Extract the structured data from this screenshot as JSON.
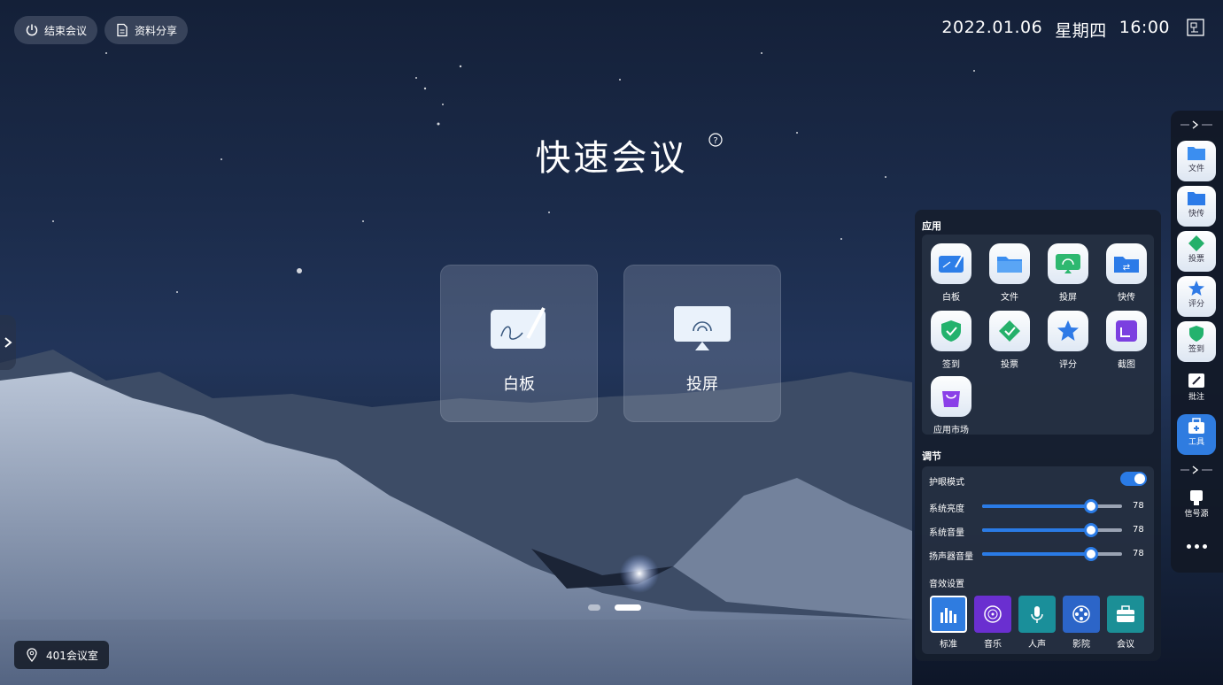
{
  "top": {
    "end_meeting": "结束会议",
    "share_material": "资料分享",
    "date": "2022.01.06",
    "weekday": "星期四",
    "time": "16:00"
  },
  "main": {
    "title": "快速会议",
    "cards": [
      {
        "label": "白板",
        "icon": "whiteboard-icon"
      },
      {
        "label": "投屏",
        "icon": "screencast-icon"
      }
    ]
  },
  "room": {
    "name": "401会议室"
  },
  "pager": {
    "pages": 2,
    "active": 2
  },
  "panel": {
    "apps_title": "应用",
    "apps": [
      {
        "label": "白板",
        "icon": "whiteboard-icon"
      },
      {
        "label": "文件",
        "icon": "folder-icon"
      },
      {
        "label": "投屏",
        "icon": "screencast-icon"
      },
      {
        "label": "快传",
        "icon": "transfer-folder-icon"
      },
      {
        "label": "签到",
        "icon": "checkin-shield-icon"
      },
      {
        "label": "投票",
        "icon": "vote-icon"
      },
      {
        "label": "评分",
        "icon": "star-icon"
      },
      {
        "label": "截图",
        "icon": "screenshot-icon"
      },
      {
        "label": "应用市场",
        "icon": "app-store-icon"
      }
    ],
    "adjust_title": "调节",
    "eye_mode": {
      "label": "护眼模式",
      "on": true
    },
    "sliders": [
      {
        "label": "系统亮度",
        "value": 78
      },
      {
        "label": "系统音量",
        "value": 78
      },
      {
        "label": "扬声器音量",
        "value": 78
      }
    ],
    "sound_title": "音效设置",
    "sound_effects": [
      {
        "label": "标准",
        "color": "#2f7ce0",
        "icon": "equalizer-icon",
        "selected": true
      },
      {
        "label": "音乐",
        "color": "#6a2fd0",
        "icon": "music-disc-icon",
        "selected": false
      },
      {
        "label": "人声",
        "color": "#1a8f9a",
        "icon": "microphone-icon",
        "selected": false
      },
      {
        "label": "影院",
        "color": "#2c65c8",
        "icon": "film-reel-icon",
        "selected": false
      },
      {
        "label": "会议",
        "color": "#1b8f96",
        "icon": "briefcase-icon",
        "selected": false
      }
    ]
  },
  "rail": {
    "items": [
      {
        "label": "文件",
        "icon": "folder-icon"
      },
      {
        "label": "快传",
        "icon": "transfer-folder-icon"
      },
      {
        "label": "投票",
        "icon": "vote-icon"
      },
      {
        "label": "评分",
        "icon": "star-icon"
      },
      {
        "label": "签到",
        "icon": "checkin-shield-icon"
      },
      {
        "label": "批注",
        "icon": "annotate-icon"
      },
      {
        "label": "工具",
        "icon": "toolbox-icon"
      },
      {
        "label": "信号源",
        "icon": "signal-source-icon"
      }
    ]
  },
  "colors": {
    "accent": "#2a7be6",
    "panel_bg": "#161e2e"
  }
}
